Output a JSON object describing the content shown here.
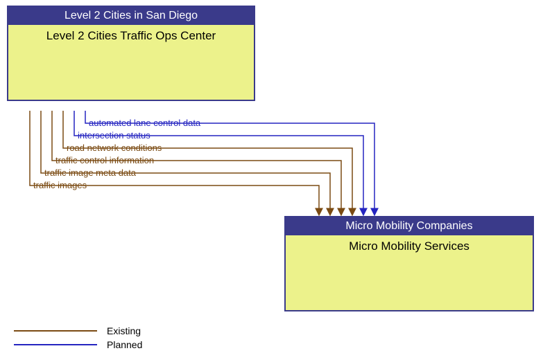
{
  "nodes": {
    "source": {
      "header": "Level 2 Cities in San Diego",
      "body": "Level 2 Cities Traffic Ops Center"
    },
    "target": {
      "header": "Micro Mobility Companies",
      "body": "Micro Mobility Services"
    }
  },
  "flows": [
    {
      "label": "automated lane control data",
      "status": "planned"
    },
    {
      "label": "intersection status",
      "status": "planned"
    },
    {
      "label": "road network conditions",
      "status": "existing"
    },
    {
      "label": "traffic control information",
      "status": "existing"
    },
    {
      "label": "traffic image meta data",
      "status": "existing"
    },
    {
      "label": "traffic images",
      "status": "existing"
    }
  ],
  "legend": {
    "existing": "Existing",
    "planned": "Planned"
  },
  "colors": {
    "existing": "#7a4a12",
    "planned": "#2424c0",
    "node_border": "#3a3a8a",
    "node_fill": "#ecf28b"
  }
}
